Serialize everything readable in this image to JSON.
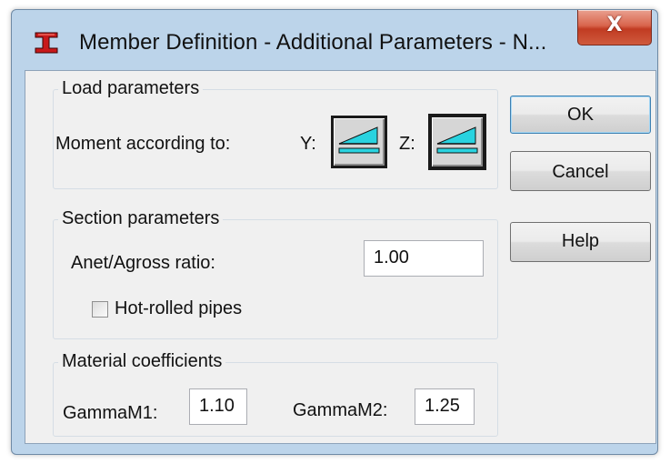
{
  "window": {
    "title": "Member Definition - Additional Parameters - N...",
    "close_glyph": "X"
  },
  "load": {
    "title": "Load parameters",
    "moment_label": "Moment according to:",
    "y_label": "Y:",
    "z_label": "Z:"
  },
  "section": {
    "title": "Section parameters",
    "ratio_label": "Anet/Agross ratio:",
    "ratio_value": "1.00",
    "hot_rolled_label": "Hot-rolled pipes",
    "hot_rolled_checked": false
  },
  "material": {
    "title": "Material coefficients",
    "gm1_label": "GammaM1:",
    "gm1_value": "1.10",
    "gm2_label": "GammaM2:",
    "gm2_value": "1.25"
  },
  "buttons": {
    "ok": "OK",
    "cancel": "Cancel",
    "help": "Help"
  },
  "colors": {
    "icon_accent": "#29d3e0",
    "close_red": "#c13b22",
    "title_bar": "#bcd4ea"
  }
}
